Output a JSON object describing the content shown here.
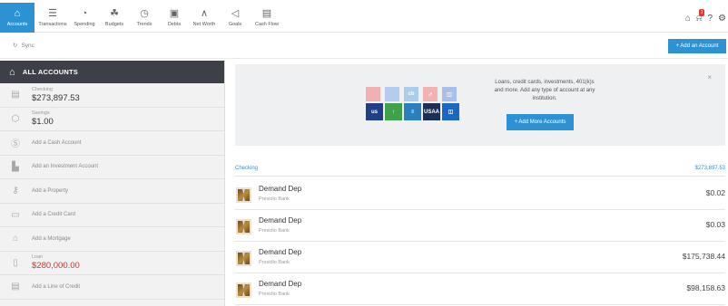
{
  "nav": {
    "items": [
      {
        "label": "Accounts",
        "icon": "bank-icon",
        "glyph": "⌂",
        "active": true
      },
      {
        "label": "Transactions",
        "icon": "list-icon",
        "glyph": "☰"
      },
      {
        "label": "Spending",
        "icon": "pie-icon",
        "glyph": "◔"
      },
      {
        "label": "Budgets",
        "icon": "budget-icon",
        "glyph": "☘"
      },
      {
        "label": "Trends",
        "icon": "clock-icon",
        "glyph": "◷"
      },
      {
        "label": "Debts",
        "icon": "debt-icon",
        "glyph": "▣"
      },
      {
        "label": "Net Worth",
        "icon": "networth-icon",
        "glyph": "∧"
      },
      {
        "label": "Goals",
        "icon": "flag-icon",
        "glyph": "◁"
      },
      {
        "label": "Cash Flow",
        "icon": "cashflow-icon",
        "glyph": "▤"
      }
    ],
    "notification_count": "1"
  },
  "subbar": {
    "sync_label": "Sync",
    "add_account_label": "+ Add an Account"
  },
  "sidebar": {
    "title": "ALL ACCOUNTS",
    "rows": [
      {
        "kind": "account",
        "icon": "checking-icon",
        "glyph": "▤",
        "label": "Checking",
        "amount": "$273,897.53"
      },
      {
        "kind": "account",
        "icon": "savings-icon",
        "glyph": "⬡",
        "label": "Savings",
        "amount": "$1.00"
      },
      {
        "kind": "add",
        "icon": "dollar-icon",
        "glyph": "Ⓢ",
        "label": "Add a Cash Account"
      },
      {
        "kind": "add",
        "icon": "investment-icon",
        "glyph": "▙",
        "label": "Add an Investment Account"
      },
      {
        "kind": "add",
        "icon": "key-icon",
        "glyph": "⚷",
        "label": "Add a Property"
      },
      {
        "kind": "add",
        "icon": "credit-card-icon",
        "glyph": "▭",
        "label": "Add a Credit Card"
      },
      {
        "kind": "add",
        "icon": "house-icon",
        "glyph": "⌂",
        "label": "Add a Mortgage"
      },
      {
        "kind": "account",
        "icon": "loan-icon",
        "glyph": "▯",
        "label": "Loan",
        "amount": "$280,000.00",
        "negative": true
      },
      {
        "kind": "add",
        "icon": "line-of-credit-icon",
        "glyph": "▤",
        "label": "Add a Line of Credit"
      }
    ]
  },
  "promo": {
    "text_plain": "Loans, credit cards, investments, 401(k)s and more.",
    "text_bold": "Add any type of account at any institution.",
    "button_label": "+ Add More Accounts",
    "close": "×",
    "logos_top": [
      {
        "color": "#f2a6a6",
        "text": ""
      },
      {
        "color": "#a9c6ee",
        "text": ""
      },
      {
        "color": "#9ec8ea",
        "text": "cb"
      },
      {
        "color": "#f2a8a8",
        "text": "↗"
      },
      {
        "color": "#9bb8e8",
        "text": "◫"
      }
    ],
    "logos_bottom": [
      {
        "color": "#1f3f86",
        "text": "us"
      },
      {
        "color": "#3fa24a",
        "text": "↑"
      },
      {
        "color": "#2a7fbf",
        "text": "≡"
      },
      {
        "color": "#1c2f55",
        "text": "USAA"
      },
      {
        "color": "#1b67c5",
        "text": "◫"
      }
    ]
  },
  "list": {
    "section_label": "Checking",
    "section_total": "$273,897.53",
    "rows": [
      {
        "name": "Demand Dep",
        "bank": "Presidio Bank",
        "balance": "$0.02"
      },
      {
        "name": "Demand Dep",
        "bank": "Presidio Bank",
        "balance": "$0.03"
      },
      {
        "name": "Demand Dep",
        "bank": "Presidio Bank",
        "balance": "$175,738.44"
      },
      {
        "name": "Demand Dep",
        "bank": "Presidio Bank",
        "balance": "$98,158.63"
      }
    ]
  },
  "colors": {
    "accent": "#2d92d3",
    "sidebar_header": "#3d4147",
    "negative": "#d0332d"
  }
}
